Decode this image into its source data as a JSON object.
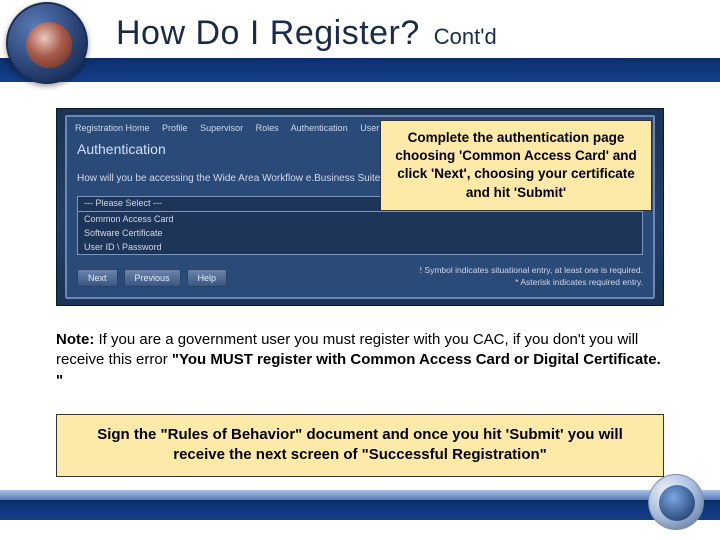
{
  "header": {
    "title": "How Do I Register?",
    "subtitle": "Cont'd"
  },
  "screenshot": {
    "tabs": [
      "Registration Home",
      "Profile",
      "Supervisor",
      "Roles",
      "Authentication",
      "User Agreement"
    ],
    "heading": "Authentication",
    "prompt": "How will you be accessing the Wide Area Workflow e.Business Suite applic",
    "select_placeholder": "--- Please Select ---",
    "options": [
      "Common Access Card",
      "Software Certificate",
      "User ID \\ Password"
    ],
    "buttons": {
      "next": "Next",
      "previous": "Previous",
      "help": "Help"
    },
    "footnote1": "! Symbol indicates situational entry, at least one is required.",
    "footnote2": "* Asterisk indicates required entry."
  },
  "callout_top": "Complete the authentication page choosing 'Common Access Card' and click 'Next', choosing your certificate and hit 'Submit'",
  "note": {
    "label": "Note:",
    "body": " If you are a government user you must register with you CAC, if you don't you will receive this error ",
    "quoted": "\"You MUST register with Common Access Card or Digital Certificate. \""
  },
  "callout_bottom": "Sign the \"Rules of Behavior\" document and once you hit 'Submit' you will receive the next screen of \"Successful Registration\""
}
